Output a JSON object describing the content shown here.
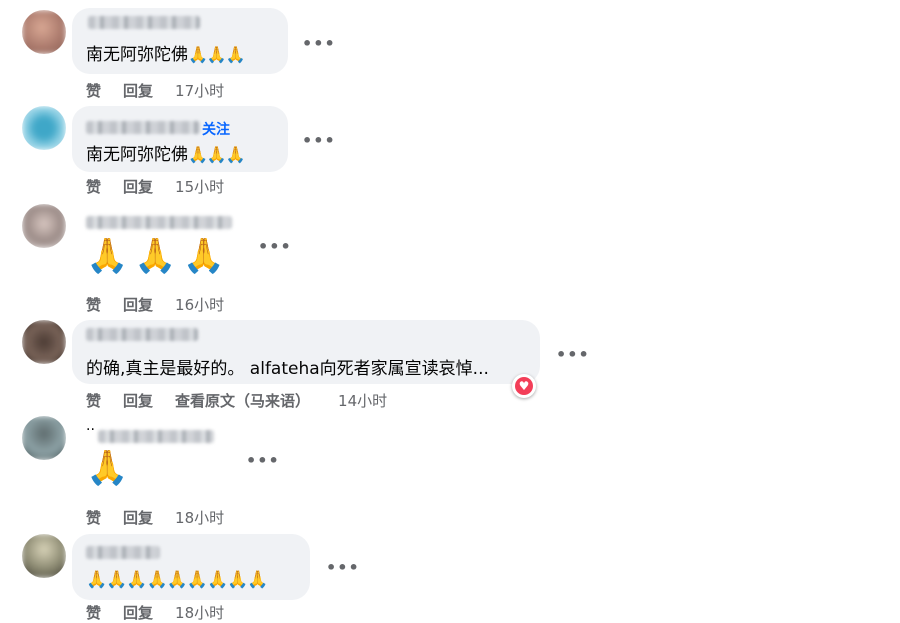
{
  "actions": {
    "like": "赞",
    "reply": "回复",
    "see_original": "查看原文（马来语）"
  },
  "comments": [
    {
      "text": "南无阿弥陀佛",
      "emoji": "🙏🙏🙏",
      "time": "17小时"
    },
    {
      "text": "南无阿弥陀佛",
      "emoji": "🙏🙏🙏",
      "time": "15小时",
      "follow": "关注"
    },
    {
      "emoji": "🙏🙏🙏",
      "time": "16小时"
    },
    {
      "text": "的确,真主是最好的。 alfateha向死者家属宣读哀悼...",
      "time": "14小时",
      "reaction": "heart"
    },
    {
      "prefix": "..",
      "emoji": "🙏",
      "time": "18小时"
    },
    {
      "emoji": "🙏🙏🙏🙏🙏🙏🙏🙏🙏",
      "time": "18小时"
    }
  ],
  "colors": {
    "bubble": "#f0f2f5",
    "meta": "#65676b",
    "follow": "#0866ff",
    "heart": "#f33e58"
  }
}
